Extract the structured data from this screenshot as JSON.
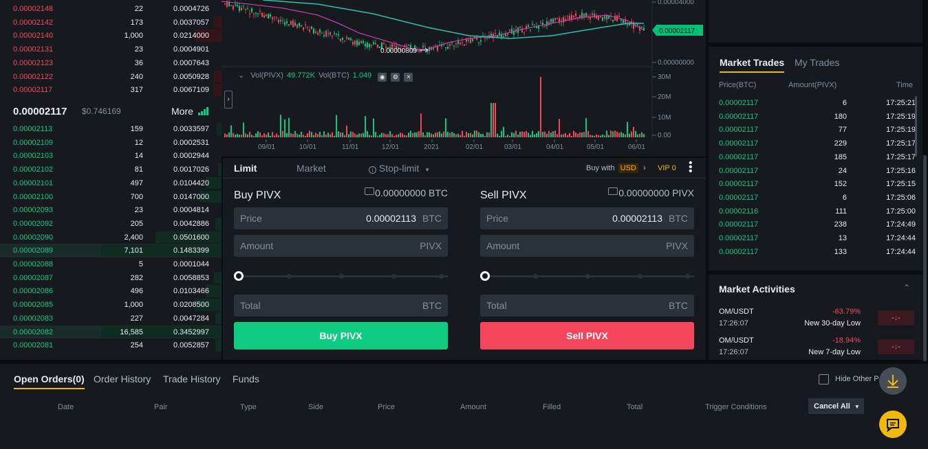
{
  "orderbook": {
    "asks": [
      {
        "price": "0.00002148",
        "amount": "22",
        "total": "0.0004726",
        "depth": 0
      },
      {
        "price": "0.00002142",
        "amount": "173",
        "total": "0.0037057",
        "depth": 0.06
      },
      {
        "price": "0.00002140",
        "amount": "1,000",
        "total": "0.0214000",
        "depth": 0.22
      },
      {
        "price": "0.00002131",
        "amount": "23",
        "total": "0.0004901",
        "depth": 0
      },
      {
        "price": "0.00002123",
        "amount": "36",
        "total": "0.0007643",
        "depth": 0
      },
      {
        "price": "0.00002122",
        "amount": "240",
        "total": "0.0050928",
        "depth": 0.06
      },
      {
        "price": "0.00002117",
        "amount": "317",
        "total": "0.0067109",
        "depth": 0.06
      }
    ],
    "mid": {
      "price": "0.00002117",
      "usd": "$0.746169",
      "more_label": "More"
    },
    "bids": [
      {
        "price": "0.00002113",
        "amount": "159",
        "total": "0.0033597",
        "depth": 0.04,
        "highlight": false
      },
      {
        "price": "0.00002109",
        "amount": "12",
        "total": "0.0002531",
        "depth": 0,
        "highlight": false
      },
      {
        "price": "0.00002103",
        "amount": "14",
        "total": "0.0002944",
        "depth": 0,
        "highlight": false
      },
      {
        "price": "0.00002102",
        "amount": "81",
        "total": "0.0017026",
        "depth": 0.03,
        "highlight": false
      },
      {
        "price": "0.00002101",
        "amount": "497",
        "total": "0.0104420",
        "depth": 0.13,
        "highlight": false
      },
      {
        "price": "0.00002100",
        "amount": "700",
        "total": "0.0147000",
        "depth": 0.18,
        "highlight": false
      },
      {
        "price": "0.00002093",
        "amount": "23",
        "total": "0.0004814",
        "depth": 0,
        "highlight": false
      },
      {
        "price": "0.00002092",
        "amount": "205",
        "total": "0.0042886",
        "depth": 0.05,
        "highlight": false
      },
      {
        "price": "0.00002090",
        "amount": "2,400",
        "total": "0.0501600",
        "depth": 0.55,
        "highlight": false
      },
      {
        "price": "0.00002089",
        "amount": "7,101",
        "total": "0.1483399",
        "depth": 1,
        "highlight": true
      },
      {
        "price": "0.00002088",
        "amount": "5",
        "total": "0.0001044",
        "depth": 0,
        "highlight": false
      },
      {
        "price": "0.00002087",
        "amount": "282",
        "total": "0.0058853",
        "depth": 0.06,
        "highlight": false
      },
      {
        "price": "0.00002086",
        "amount": "496",
        "total": "0.0103466",
        "depth": 0.13,
        "highlight": false
      },
      {
        "price": "0.00002085",
        "amount": "1,000",
        "total": "0.0208500",
        "depth": 0.22,
        "highlight": false
      },
      {
        "price": "0.00002083",
        "amount": "227",
        "total": "0.0047284",
        "depth": 0.05,
        "highlight": false
      },
      {
        "price": "0.00002082",
        "amount": "16,585",
        "total": "0.3452997",
        "depth": 1,
        "highlight": true
      },
      {
        "price": "0.00002081",
        "amount": "254",
        "total": "0.0052857",
        "depth": 0.05,
        "highlight": false
      }
    ]
  },
  "chart": {
    "price_axis": [
      "0.00004000",
      "0.00000000"
    ],
    "current_price_tag": "0.00002117",
    "low_marker": "0.00000809",
    "volume_legend": {
      "label": "Vol(PIVX)",
      "pivx": "49.772K",
      "btc_label": "Vol(BTC)",
      "btc": "1.049"
    },
    "volume_axis": [
      "30M",
      "20M",
      "10M",
      "0.00"
    ],
    "time_axis": [
      "09/01",
      "10/01",
      "11/01",
      "12/01",
      "2021",
      "02/01",
      "03/01",
      "04/01",
      "05/01",
      "06/01"
    ],
    "colors": {
      "up": "#0ecb81",
      "down": "#f6465d",
      "ma1": "#c03fa6",
      "ma2": "#2ebfb3"
    }
  },
  "form": {
    "tabs": {
      "limit": "Limit",
      "market": "Market",
      "stop": "Stop-limit"
    },
    "buy_with_label": "Buy with",
    "currency": "USD",
    "vip": "VIP 0",
    "buy": {
      "title": "Buy PIVX",
      "balance": "0.00000000 BTC",
      "price_label": "Price",
      "price_value": "0.00002113",
      "price_unit": "BTC",
      "amount_label": "Amount",
      "amount_unit": "PIVX",
      "total_label": "Total",
      "total_unit": "BTC",
      "button": "Buy PIVX",
      "slider_level": 0
    },
    "sell": {
      "title": "Sell PIVX",
      "balance": "0.00000000 PIVX",
      "price_label": "Price",
      "price_value": "0.00002113",
      "price_unit": "BTC",
      "amount_label": "Amount",
      "amount_unit": "PIVX",
      "total_label": "Total",
      "total_unit": "BTC",
      "button": "Sell PIVX",
      "slider_level": 0
    }
  },
  "trades": {
    "tabs": [
      "Market Trades",
      "My Trades"
    ],
    "headers": [
      "Price(BTC)",
      "Amount(PIVX)",
      "Time"
    ],
    "rows": [
      {
        "price": "0.00002117",
        "amount": "6",
        "time": "17:25:21"
      },
      {
        "price": "0.00002117",
        "amount": "180",
        "time": "17:25:19"
      },
      {
        "price": "0.00002117",
        "amount": "77",
        "time": "17:25:19"
      },
      {
        "price": "0.00002117",
        "amount": "229",
        "time": "17:25:17"
      },
      {
        "price": "0.00002117",
        "amount": "185",
        "time": "17:25:17"
      },
      {
        "price": "0.00002117",
        "amount": "24",
        "time": "17:25:16"
      },
      {
        "price": "0.00002117",
        "amount": "152",
        "time": "17:25:15"
      },
      {
        "price": "0.00002117",
        "amount": "6",
        "time": "17:25:06"
      },
      {
        "price": "0.00002116",
        "amount": "111",
        "time": "17:25:00"
      },
      {
        "price": "0.00002117",
        "amount": "238",
        "time": "17:24:49"
      },
      {
        "price": "0.00002117",
        "amount": "13",
        "time": "17:24:44"
      },
      {
        "price": "0.00002117",
        "amount": "133",
        "time": "17:24:44"
      }
    ]
  },
  "activities": {
    "title": "Market Activities",
    "items": [
      {
        "pair": "OM/USDT",
        "time": "17:26:07",
        "change": "-63.79%",
        "desc": "New 30-day Low"
      },
      {
        "pair": "OM/USDT",
        "time": "17:26:07",
        "change": "-18.94%",
        "desc": "New 7-day Low"
      }
    ]
  },
  "bottom": {
    "tabs": [
      "Open Orders(0)",
      "Order History",
      "Trade History",
      "Funds"
    ],
    "hide_other_label": "Hide Other P",
    "columns": [
      "Date",
      "Pair",
      "Type",
      "Side",
      "Price",
      "Amount",
      "Filled",
      "Total",
      "Trigger Conditions"
    ],
    "cancel_all": "Cancel All"
  }
}
